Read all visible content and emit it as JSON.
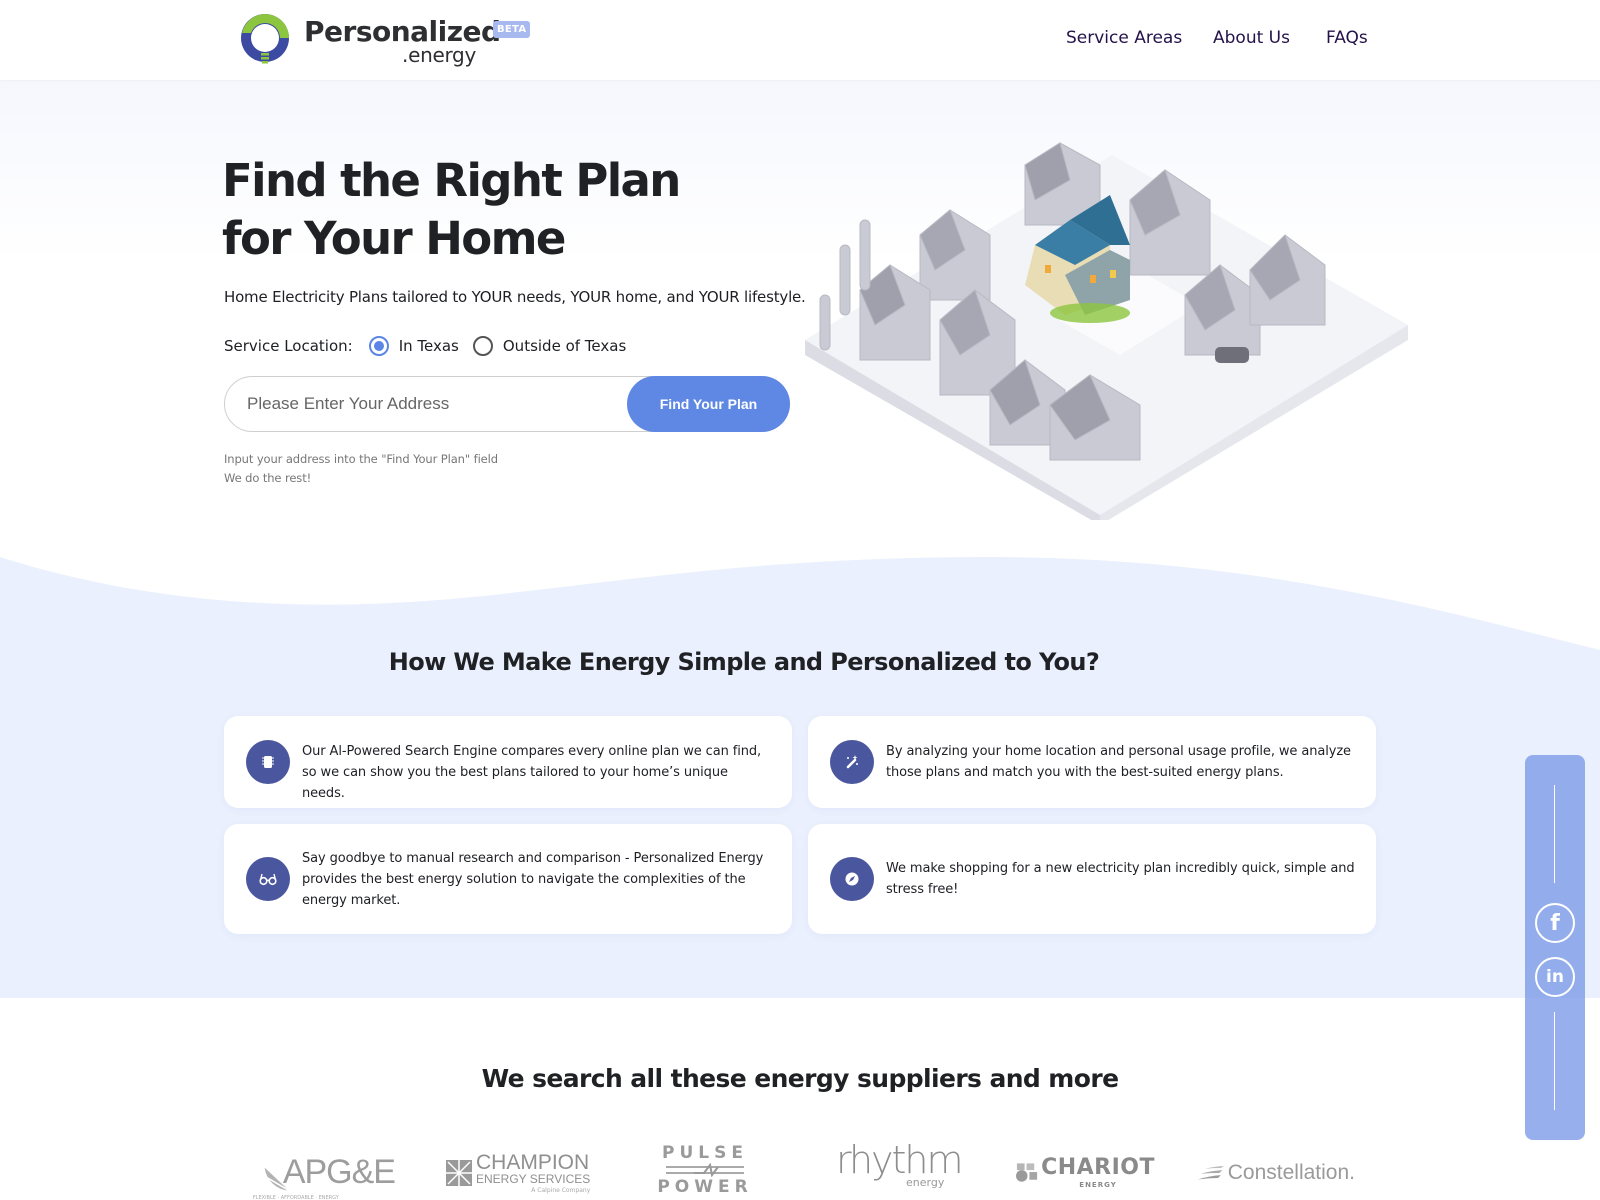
{
  "header": {
    "logo": {
      "name": "Personalized",
      "sub": ".energy",
      "badge": "BETA"
    },
    "nav": [
      {
        "label": "Service Areas"
      },
      {
        "label": "About Us"
      },
      {
        "label": "FAQs"
      }
    ]
  },
  "hero": {
    "title_line1": "Find the Right Plan",
    "title_line2": "for Your Home",
    "subtitle": "Home Electricity Plans tailored to YOUR needs, YOUR home, and YOUR lifestyle.",
    "service_location": {
      "label": "Service Location:",
      "options": [
        {
          "label": "In Texas",
          "selected": true
        },
        {
          "label": "Outside of Texas",
          "selected": false
        }
      ]
    },
    "address_input": {
      "placeholder": "Please Enter Your Address",
      "value": ""
    },
    "find_button": "Find Your Plan",
    "hint_line1": "Input your address into the \"Find Your Plan\" field",
    "hint_line2": "We do the rest!",
    "illustration_alt": "isometric-neighborhood-illustration"
  },
  "features": {
    "title": "How We Make Energy Simple and Personalized to You?",
    "cards": [
      {
        "icon": "chip-icon",
        "text": "Our Al-Powered Search Engine compares every online plan we can find, so we can show you the best plans tailored to your home’s unique needs."
      },
      {
        "icon": "magic-wand-icon",
        "text": "By analyzing your home location and personal usage profile, we analyze those plans and match you with the best-suited energy plans."
      },
      {
        "icon": "glasses-icon",
        "text": "Say goodbye to manual research and comparison - Personalized Energy provides the best energy solution to navigate the complexities of the energy market."
      },
      {
        "icon": "compass-icon",
        "text": "We make shopping for a new electricity plan incredibly quick, simple and stress free!"
      }
    ]
  },
  "social": [
    {
      "name": "facebook",
      "glyph": "f"
    },
    {
      "name": "linkedin",
      "glyph": "in"
    }
  ],
  "suppliers": {
    "title": "We search all these energy suppliers and more",
    "logos": [
      {
        "name": "APG&E",
        "tagline": "FLEXIBLE · AFFORDABLE · ENERGY"
      },
      {
        "name": "CHAMPION",
        "line2": "ENERGY SERVICES",
        "tagline": "A Calpine Company"
      },
      {
        "name": "PULSE",
        "line2": "POWER"
      },
      {
        "name": "rhythm",
        "line2": "energy"
      },
      {
        "name": "CHARIOT",
        "line2": "ENERGY"
      },
      {
        "name": "Constellation."
      }
    ]
  },
  "colors": {
    "accent": "#5e88e3",
    "nav_text": "#24124a",
    "icon_bg": "#4a569d",
    "section_bg": "#eaf0fd",
    "social_bg": "#809ee8",
    "logo_green": "#8cc63f",
    "logo_blue": "#3b4aa0"
  }
}
